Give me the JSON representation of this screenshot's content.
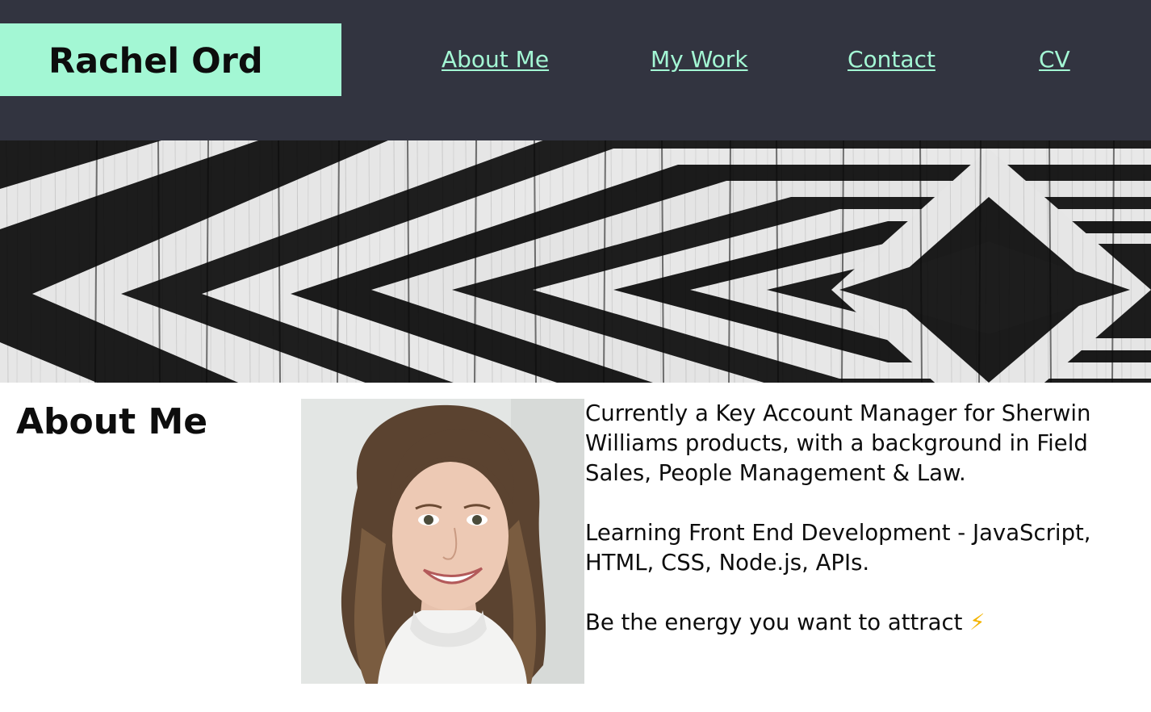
{
  "header": {
    "brand": "Rachel Ord",
    "nav": [
      "About Me",
      "My Work",
      "Contact",
      "CV"
    ]
  },
  "about": {
    "heading": "About Me",
    "paragraphs": [
      "Currently a Key Account Manager for Sherwin Williams products, with a background in Field Sales, People Management & Law.",
      "Learning Front End Development - JavaScript, HTML, CSS, Node.js, APIs."
    ],
    "tagline": "Be the energy you want to attract",
    "tagline_icon": "⚡"
  },
  "colors": {
    "header_bg": "#323440",
    "accent": "#a3f7d4",
    "text": "#0d0d0d"
  }
}
